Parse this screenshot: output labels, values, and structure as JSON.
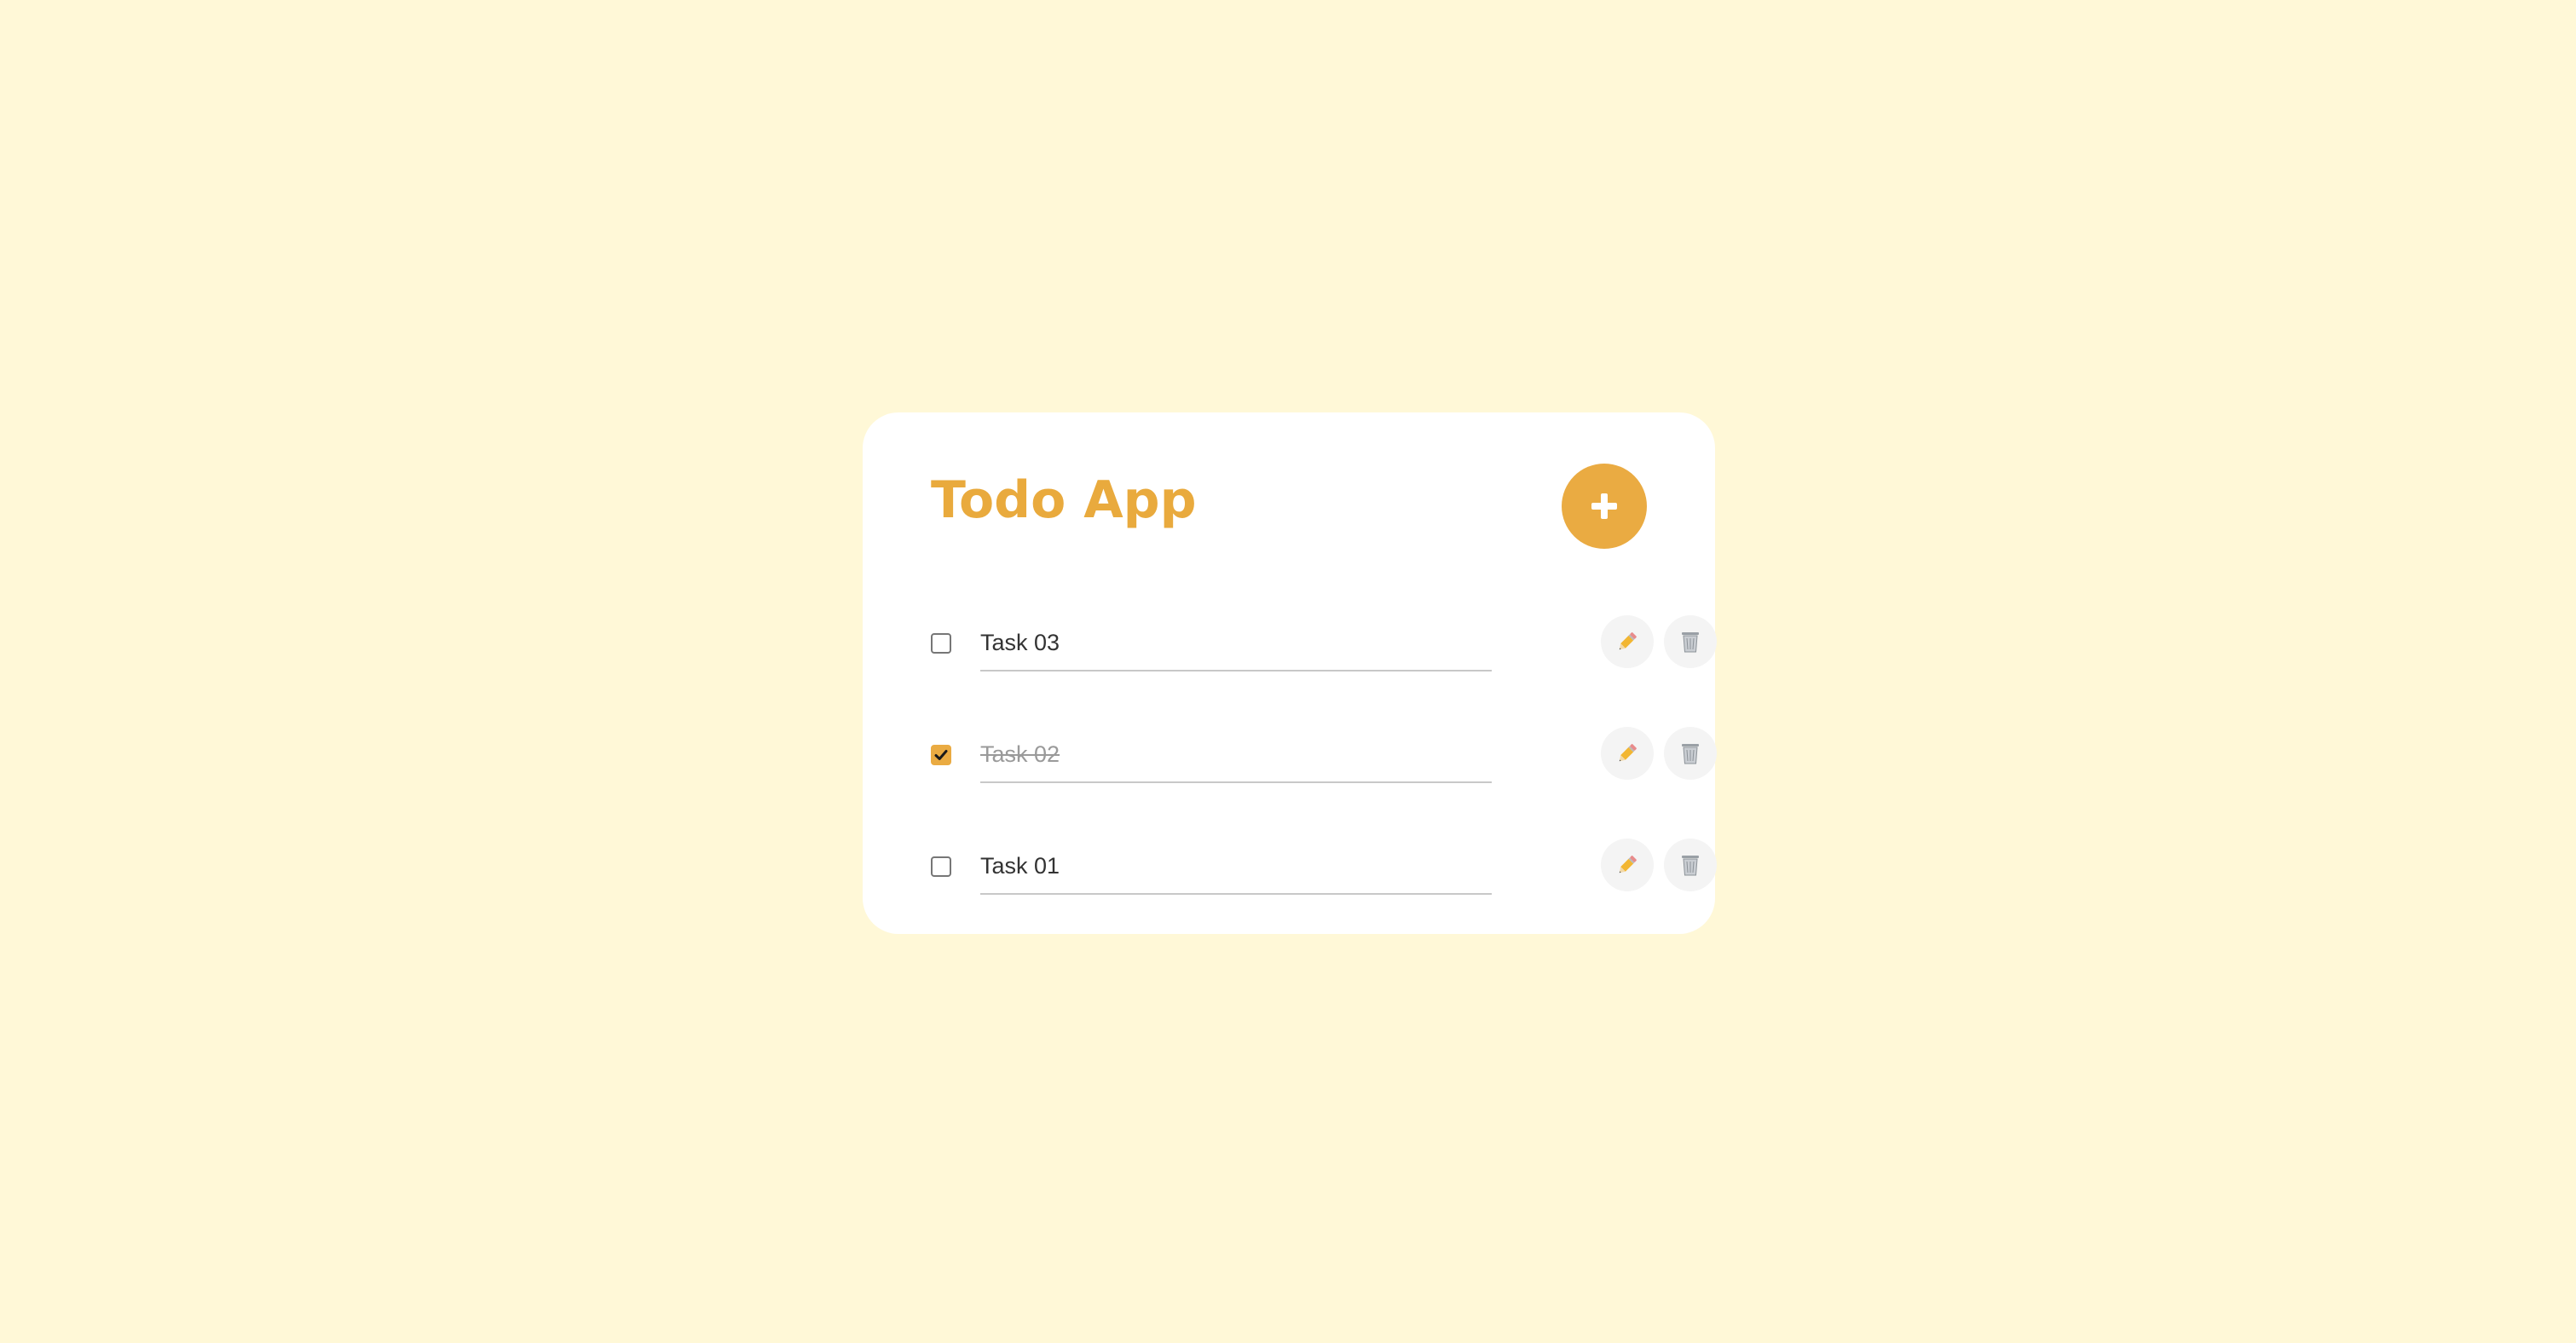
{
  "app": {
    "title": "Todo App"
  },
  "colors": {
    "background": "#fff8d7",
    "card": "#ffffff",
    "accent": "#eaab42",
    "title": "#e9aa3d"
  },
  "header": {
    "add_button_icon": "plus-icon"
  },
  "tasks": [
    {
      "text": "Task 03",
      "completed": false,
      "edit_icon": "pencil-icon",
      "delete_icon": "trash-icon"
    },
    {
      "text": "Task 02",
      "completed": true,
      "edit_icon": "pencil-icon",
      "delete_icon": "trash-icon"
    },
    {
      "text": "Task 01",
      "completed": false,
      "edit_icon": "pencil-icon",
      "delete_icon": "trash-icon"
    }
  ]
}
